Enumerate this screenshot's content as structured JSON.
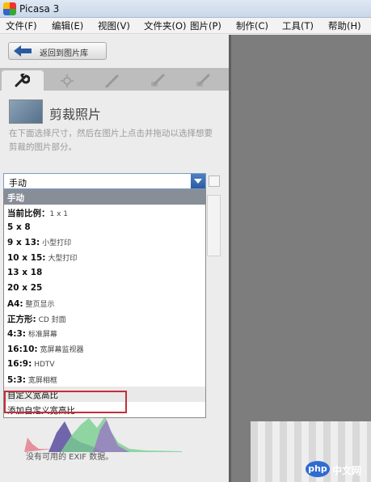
{
  "window": {
    "title": "Picasa 3"
  },
  "menu": [
    "文件(F)",
    "编辑(E)",
    "视图(V)",
    "文件夹(O)",
    "图片(P)",
    "制作(C)",
    "工具(T)",
    "帮助(H)"
  ],
  "toolbar": {
    "back_label": "返回到图片库"
  },
  "crop": {
    "title": "剪裁照片",
    "description": "在下面选择尺寸，然后在图片上点击并拖动以选择想要剪裁的图片部分。"
  },
  "dropdown": {
    "selected": "手动",
    "options": [
      {
        "bold": "手动",
        "sub": ""
      },
      {
        "bold": "当前比例：",
        "sub": "1 x 1"
      },
      {
        "bold": "5 x 8",
        "sub": ""
      },
      {
        "bold": "9 x 13:",
        "sub": " 小型打印"
      },
      {
        "bold": "10 x 15:",
        "sub": " 大型打印"
      },
      {
        "bold": "13 x 18",
        "sub": ""
      },
      {
        "bold": "20 x 25",
        "sub": ""
      },
      {
        "bold": "A4:",
        "sub": " 整页显示"
      },
      {
        "bold": "正方形:",
        "sub": " CD 封面"
      },
      {
        "bold": "4:3:",
        "sub": " 标准屏幕"
      },
      {
        "bold": "16:10:",
        "sub": " 宽屏幕监视器"
      },
      {
        "bold": "16:9:",
        "sub": " HDTV"
      },
      {
        "bold": "5:3:",
        "sub": " 宽屏相框"
      },
      {
        "bold": "自定义宽高比",
        "sub": ""
      },
      {
        "bold": "添加自定义宽高比...",
        "sub": ""
      }
    ]
  },
  "histogram": {
    "no_exif": "没有可用的 EXIF 数据。"
  },
  "watermark": {
    "logo": "php",
    "text": "中文网"
  },
  "colors": {
    "selected_row": "#888e98",
    "highlight": "#c0303a",
    "viewer_bg": "#7d7d7d"
  }
}
